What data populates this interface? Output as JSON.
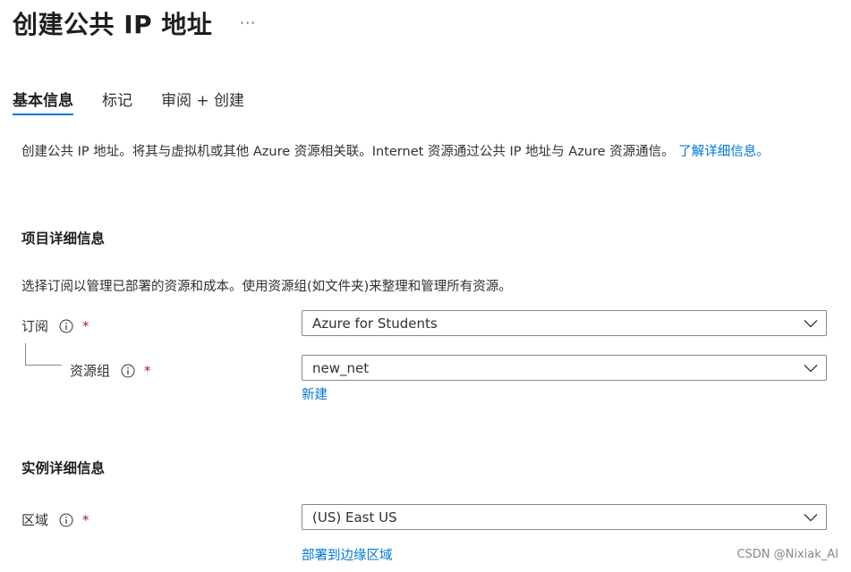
{
  "header": {
    "title": "创建公共 IP 地址",
    "more_label": "···"
  },
  "tabs": [
    {
      "label": "基本信息",
      "active": true
    },
    {
      "label": "标记",
      "active": false
    },
    {
      "label": "审阅 + 创建",
      "active": false
    }
  ],
  "intro": {
    "text": "创建公共 IP 地址。将其与虚拟机或其他 Azure 资源相关联。Internet 资源通过公共 IP 地址与 Azure 资源通信。",
    "link": "了解详细信息。"
  },
  "project_details": {
    "title": "项目详细信息",
    "description": "选择订阅以管理已部署的资源和成本。使用资源组(如文件夹)来整理和管理所有资源。",
    "subscription": {
      "label": "订阅",
      "required": "*",
      "value": "Azure for Students"
    },
    "resource_group": {
      "label": "资源组",
      "required": "*",
      "value": "new_net",
      "create_link": "新建"
    }
  },
  "instance_details": {
    "title": "实例详细信息",
    "region": {
      "label": "区域",
      "required": "*",
      "value": "(US) East US",
      "edge_link": "部署到边缘区域"
    }
  },
  "watermark": "CSDN @Nixiak_AI",
  "colors": {
    "accent": "#0078d4",
    "required": "#a4262c",
    "border": "#8a8886"
  }
}
